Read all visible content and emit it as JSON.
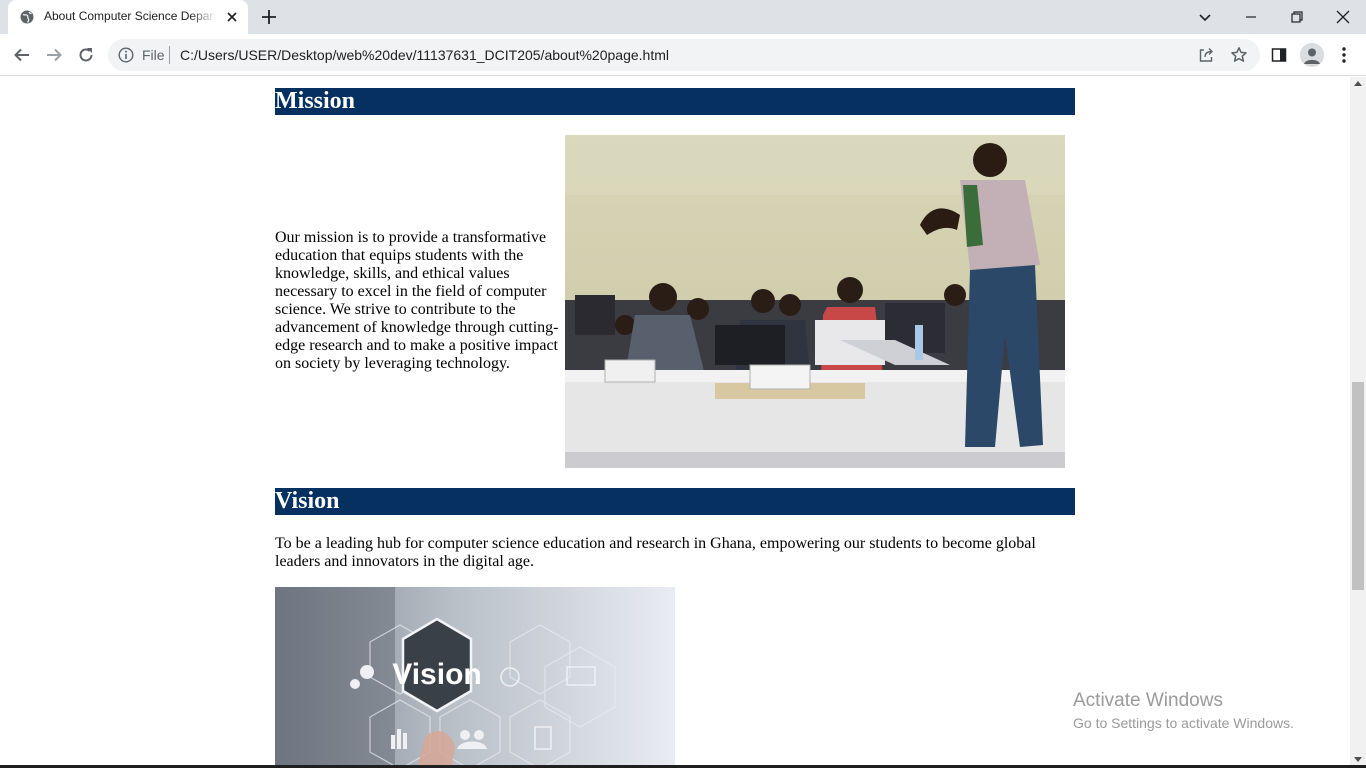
{
  "browser": {
    "tab_title": "About Computer Science Department",
    "url_scheme_label": "File",
    "url": "C:/Users/USER/Desktop/web%20dev/11137631_DCIT205/about%20page.html"
  },
  "page": {
    "mission": {
      "heading": "Mission",
      "text": "Our mission is to provide a transformative education that equips students with the knowledge, skills, and ethical values necessary to excel in the field of computer science. We strive to contribute to the advancement of knowledge through cutting-edge research and to make a positive impact on society by leveraging technology."
    },
    "vision": {
      "heading": "Vision",
      "text": "To be a leading hub for computer science education and research in Ghana, empowering our students to become global leaders and innovators in the digital age.",
      "image_word": "Vision"
    }
  },
  "watermark": {
    "title": "Activate Windows",
    "subtitle": "Go to Settings to activate Windows."
  },
  "colors": {
    "heading_bg": "#05305f",
    "tabstrip_bg": "#dee1e6"
  }
}
